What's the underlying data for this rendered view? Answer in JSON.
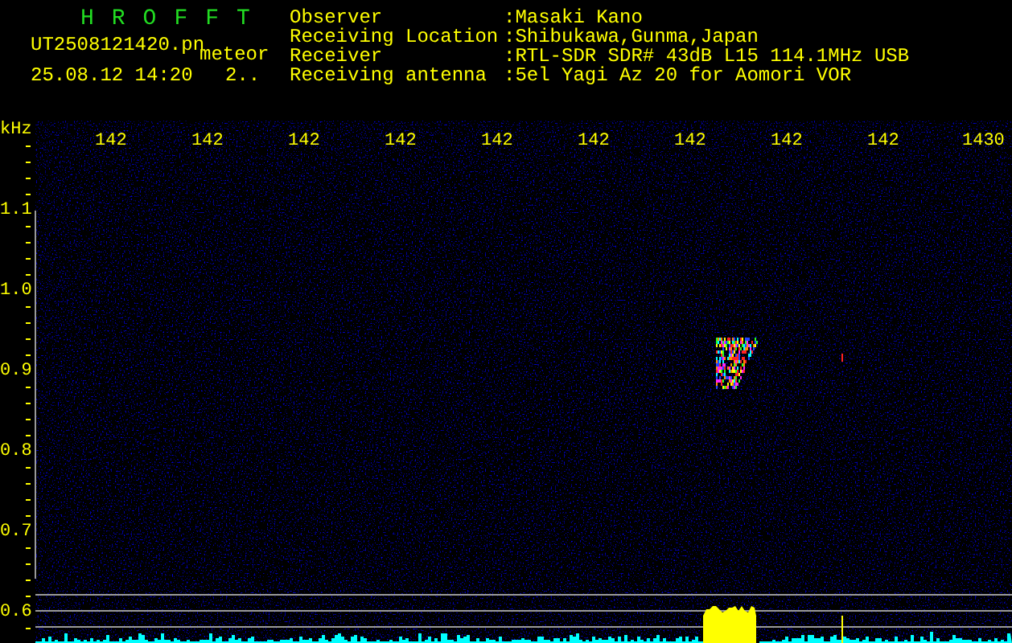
{
  "header": {
    "title": "HROFFT",
    "file_name": "UT2508121420.pn",
    "tag": "meteor",
    "timestamp": "25.08.12 14:20",
    "count": "2.."
  },
  "station_info": [
    {
      "label": "Observer",
      "value": ":Masaki Kano"
    },
    {
      "label": "Receiving Location",
      "value": ":Shibukawa,Gunma,Japan"
    },
    {
      "label": "Receiver",
      "value": ":RTL-SDR SDR# 43dB L15 114.1MHz USB"
    },
    {
      "label": "Receiving antenna",
      "value": ":5el Yagi Az 20 for Aomori VOR"
    }
  ],
  "spectrogram": {
    "unit_label": "kHz",
    "frequency_labels": [
      "142",
      "142",
      "142",
      "142",
      "142",
      "142",
      "142",
      "142",
      "142",
      "1430"
    ],
    "amplitude_labels": [
      "1.1",
      "1.0",
      "0.9",
      "0.8",
      "0.7",
      "0.6"
    ]
  }
}
